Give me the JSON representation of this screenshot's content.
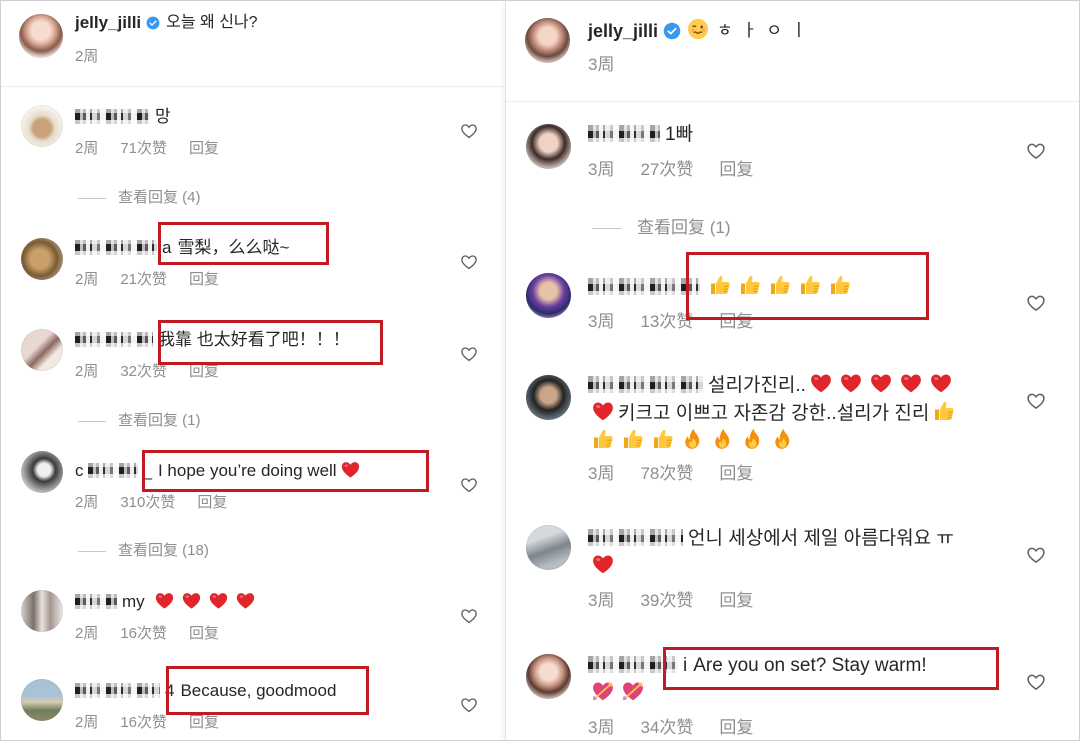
{
  "colors": {
    "text": "#262626",
    "meta": "#8e8e8e",
    "verified": "#3897f0",
    "highlight": "#c21a23",
    "like_icon": "#5f5f5f"
  },
  "icons": {
    "verified": "verified-badge",
    "like": "like-heart"
  },
  "panels": [
    {
      "post": {
        "username": "jelly_jilli",
        "caption": [
          {
            "text": "오늘 왜 신나?"
          }
        ],
        "time": "2周"
      },
      "items": [
        {
          "type": "comment",
          "name_prefix": "",
          "name_suffix": "",
          "tokens": [
            {
              "text": "망"
            }
          ],
          "time": "2周",
          "likes": "71次赞",
          "reply": "回复"
        },
        {
          "type": "view_replies",
          "label": "查看回复 (4)"
        },
        {
          "type": "comment",
          "name_prefix": "",
          "name_suffix": "a",
          "tokens": [
            {
              "text": "雪梨，么么哒~"
            }
          ],
          "time": "2周",
          "likes": "21次赞",
          "reply": "回复"
        },
        {
          "type": "comment",
          "name_prefix": "",
          "name_suffix": "",
          "tokens": [
            {
              "text": "我靠 也太好看了吧！！！"
            }
          ],
          "time": "2周",
          "likes": "32次赞",
          "reply": "回复"
        },
        {
          "type": "view_replies",
          "label": "查看回复 (1)"
        },
        {
          "type": "comment",
          "name_prefix": "c",
          "name_suffix": "_",
          "tokens": [
            {
              "text": "I hope you’re doing well"
            },
            {
              "emoji": "red-heart"
            }
          ],
          "time": "2周",
          "likes": "310次赞",
          "reply": "回复"
        },
        {
          "type": "view_replies",
          "label": "查看回复 (18)"
        },
        {
          "type": "comment",
          "name_prefix": "",
          "name_suffix": "my",
          "tokens": [
            {
              "emoji": "red-heart"
            },
            {
              "emoji": "red-heart"
            },
            {
              "emoji": "red-heart"
            },
            {
              "emoji": "red-heart"
            }
          ],
          "time": "2周",
          "likes": "16次赞",
          "reply": "回复"
        },
        {
          "type": "comment",
          "name_prefix": "",
          "name_suffix": "4",
          "tokens": [
            {
              "text": "Because, goodmood"
            }
          ],
          "time": "2周",
          "likes": "16次赞",
          "reply": "回复"
        }
      ]
    },
    {
      "post": {
        "username": "jelly_jilli",
        "caption": [
          {
            "emoji": "woozy-face"
          },
          {
            "text": "ㅎㅏㅇㅣ"
          }
        ],
        "time": "3周"
      },
      "items": [
        {
          "type": "comment",
          "name_prefix": "",
          "name_suffix": "",
          "tokens": [
            {
              "text": "1빠"
            }
          ],
          "time": "3周",
          "likes": "27次赞",
          "reply": "回复"
        },
        {
          "type": "view_replies",
          "label": "查看回复 (1)"
        },
        {
          "type": "comment",
          "name_prefix": "",
          "name_suffix": "",
          "tokens": [
            {
              "emoji": "thumbs-up"
            },
            {
              "emoji": "thumbs-up"
            },
            {
              "emoji": "thumbs-up"
            },
            {
              "emoji": "thumbs-up"
            },
            {
              "emoji": "thumbs-up"
            }
          ],
          "time": "3周",
          "likes": "13次赞",
          "reply": "回复"
        },
        {
          "type": "comment",
          "name_prefix": "",
          "name_suffix": "",
          "tokens": [
            {
              "text": "설리가진리.."
            },
            {
              "emoji": "red-heart"
            },
            {
              "emoji": "red-heart"
            },
            {
              "emoji": "red-heart"
            },
            {
              "emoji": "red-heart"
            },
            {
              "emoji": "red-heart"
            },
            {
              "emoji": "red-heart"
            },
            {
              "text": "키크고 이쁘고 자존감 강한..설리가 진리"
            },
            {
              "emoji": "thumbs-up"
            },
            {
              "emoji": "thumbs-up"
            },
            {
              "emoji": "thumbs-up"
            },
            {
              "emoji": "thumbs-up"
            },
            {
              "emoji": "fire"
            },
            {
              "emoji": "fire"
            },
            {
              "emoji": "fire"
            },
            {
              "emoji": "fire"
            }
          ],
          "time": "3周",
          "likes": "78次赞",
          "reply": "回复"
        },
        {
          "type": "comment",
          "name_prefix": "",
          "name_suffix": "",
          "tokens": [
            {
              "text": "언니 세상에서 제일 아름다워요 ㅠ"
            },
            {
              "emoji": "red-heart"
            }
          ],
          "time": "3周",
          "likes": "39次赞",
          "reply": "回复"
        },
        {
          "type": "comment",
          "name_prefix": "",
          "name_suffix": "i",
          "tokens": [
            {
              "text": "Are you on set? Stay warm!"
            },
            {
              "emoji": "heart-with-arrow"
            },
            {
              "emoji": "heart-with-arrow"
            }
          ],
          "time": "3周",
          "likes": "34次赞",
          "reply": "回复"
        }
      ]
    }
  ]
}
